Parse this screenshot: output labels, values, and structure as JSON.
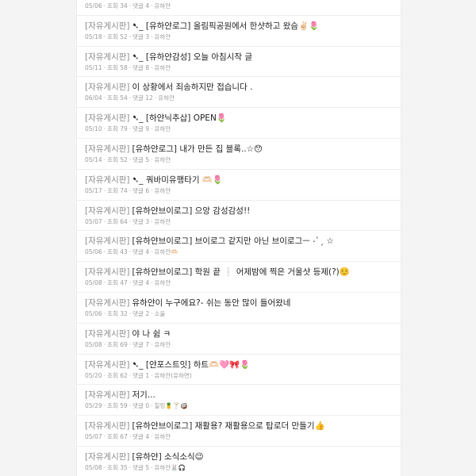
{
  "posts": [
    {
      "board": "[자유게시판]",
      "title": "",
      "date": "05/06",
      "views": "조회 34",
      "comments": "댓글 4",
      "author": "유하얀"
    },
    {
      "board": "[자유게시판]",
      "title": "➷_ [유하얀로그] 올림픽공원에서 한샷하고 왔슴✌🏻🌷",
      "date": "05/18",
      "views": "조회 52",
      "comments": "댓글 3",
      "author": "유하얀"
    },
    {
      "board": "[자유게시판]",
      "title": "➷_ [유하얀감성] 오늘 아침시작 글",
      "date": "05/11",
      "views": "조회 58",
      "comments": "댓글 8",
      "author": "유하얀"
    },
    {
      "board": "[자유게시판]",
      "title": "이 상황에서 죄송하지만 접습니다 .",
      "date": "06/04",
      "views": "조회 54",
      "comments": "댓글 12",
      "author": "유하얀"
    },
    {
      "board": "[자유게시판]",
      "title": "➷_ [하얀닉추삽] OPEN🌷",
      "date": "05/10",
      "views": "조회 79",
      "comments": "댓글 9",
      "author": "유하얀"
    },
    {
      "board": "[자유게시판]",
      "title": "[유하얀로그] 내가 만든 집 블록..☆😯",
      "date": "05/14",
      "views": "조회 52",
      "comments": "댓글 5",
      "author": "유하얀"
    },
    {
      "board": "[자유게시판]",
      "title": "➷_ 쿼바미유행타기 🫶🏻🌷",
      "date": "05/17",
      "views": "조회 74",
      "comments": "댓글 6",
      "author": "유하얀"
    },
    {
      "board": "[자유게시판]",
      "title": "[유하얀브이로그] 으앙 감성감성!!",
      "date": "05/07",
      "views": "조회 64",
      "comments": "댓글 3",
      "author": "유하얀"
    },
    {
      "board": "[자유게시판]",
      "title": "[유하얀브이로그] 브이로그 같지만 아닌 브이로그ㅡ ˗ˋˏ ☆",
      "date": "05/06",
      "views": "조회 43",
      "comments": "댓글 4",
      "author": "유하얀🫶🏻"
    },
    {
      "board": "[자유게시판]",
      "title": "[유하얀브이로그] 학원 끝 ❕ 어제밤에 찍은 거울샷 등제(?)☺️",
      "date": "05/08",
      "views": "조회 47",
      "comments": "댓글 4",
      "author": "유하얀"
    },
    {
      "board": "[자유게시판]",
      "title": "유하얀이 누구에요?- 쉬는 동안 많이 들어왔네",
      "date": "05/06",
      "views": "조회 32",
      "comments": "댓글 2",
      "author": "소울"
    },
    {
      "board": "[자유게시판]",
      "title": "야 나 쉼 ㅋ",
      "date": "05/08",
      "views": "조회 69",
      "comments": "댓글 7",
      "author": "유하얀"
    },
    {
      "board": "[자유게시판]",
      "title": "➷_ [얀포스트잇] 하트🫶🏻🩷🎀🌷",
      "date": "05/20",
      "views": "조회 62",
      "comments": "댓글 1",
      "author": "유하얀(유하연)"
    },
    {
      "board": "[자유게시판]",
      "title": "저기...",
      "date": "05/29",
      "views": "조회 59",
      "comments": "댓글 0",
      "author": "힐링🍍🍸🥥"
    },
    {
      "board": "[자유게시판]",
      "title": "[유하얀브이로그] 재활용? 재활용으로 탑로더 만들기👍",
      "date": "05/07",
      "views": "조회 67",
      "comments": "댓글 4",
      "author": "유하얀"
    },
    {
      "board": "[자유게시판]",
      "title": "[유하얀] 소식소식😉",
      "date": "05/08",
      "views": "조회 35",
      "comments": "댓글 5",
      "author": "유하얀🐰🎧"
    }
  ]
}
